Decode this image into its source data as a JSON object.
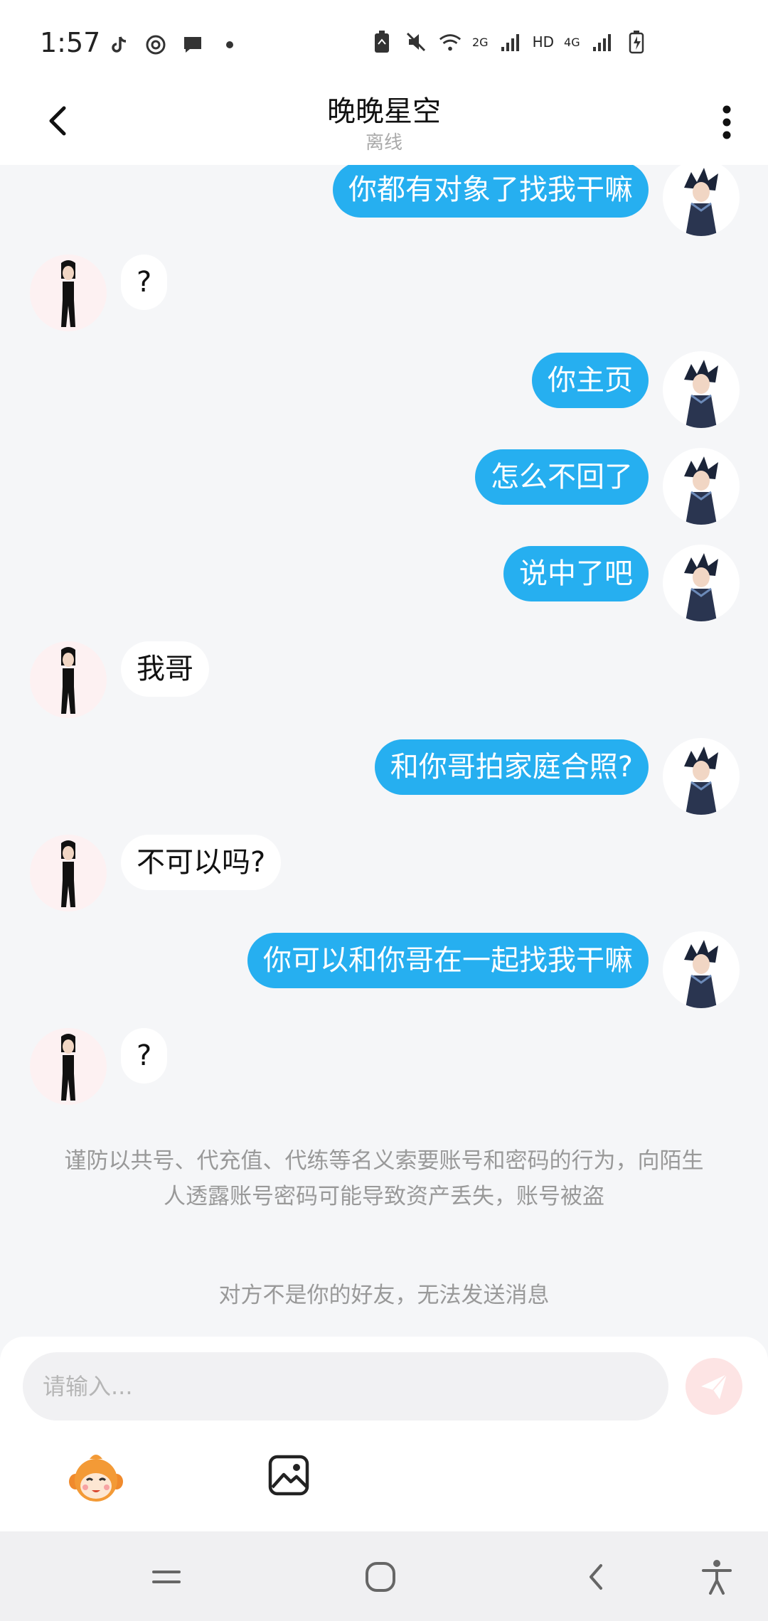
{
  "status_bar": {
    "time": "1:57",
    "hd_label": "HD",
    "net_2g": "2G",
    "net_4g": "4G"
  },
  "header": {
    "title": "晚晚星空",
    "subtitle": "离线"
  },
  "messages": [
    {
      "sender": "me",
      "text": "你都有对象了找我干嘛"
    },
    {
      "sender": "her",
      "text": "?"
    },
    {
      "sender": "me",
      "text": "你主页"
    },
    {
      "sender": "me",
      "text": "怎么不回了"
    },
    {
      "sender": "me",
      "text": "说中了吧"
    },
    {
      "sender": "her",
      "text": "我哥"
    },
    {
      "sender": "me",
      "text": "和你哥拍家庭合照?"
    },
    {
      "sender": "her",
      "text": "不可以吗?"
    },
    {
      "sender": "me",
      "text": "你可以和你哥在一起找我干嘛"
    },
    {
      "sender": "her",
      "text": "?"
    }
  ],
  "notice": "谨防以共号、代充值、代练等名义索要账号和密码的行为，向陌生人透露账号密码可能导致资产丢失，账号被盗",
  "not_friend": "对方不是你的好友，无法发送消息",
  "input": {
    "placeholder": "请输入..."
  },
  "icons": [
    "back-arrow",
    "more-vertical",
    "send",
    "emoji-monkey",
    "image",
    "menu",
    "home",
    "back",
    "accessibility"
  ],
  "colors": {
    "my_bubble": "#26aff0",
    "their_bubble": "#ffffff",
    "background": "#f5f6f8",
    "send_disabled": "#fde4e4"
  }
}
